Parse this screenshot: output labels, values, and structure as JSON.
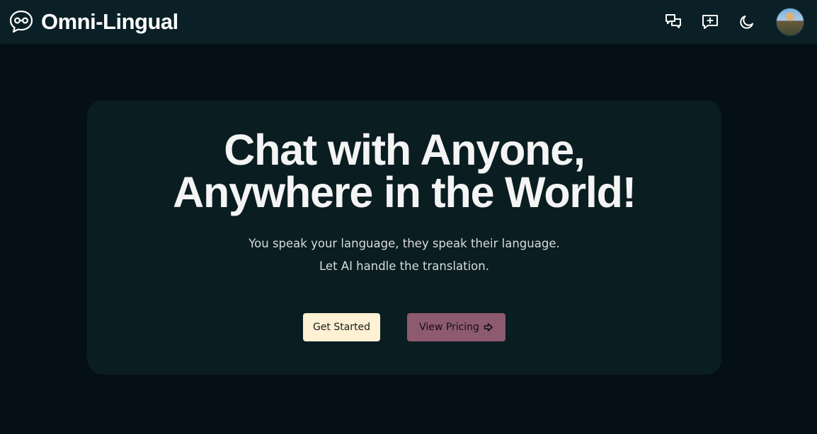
{
  "header": {
    "brand_name": "Omni-Lingual",
    "icons": [
      "chat-bubbles-icon",
      "new-chat-icon",
      "moon-icon"
    ]
  },
  "hero": {
    "title_line_1": "Chat with Anyone,",
    "title_line_2": "Anywhere in the World!",
    "subtitle_line_1": "You speak your language, they speak their language.",
    "subtitle_line_2": "Let AI handle the translation."
  },
  "cta": {
    "get_started_label": "Get Started",
    "view_pricing_label": "View Pricing"
  },
  "colors": {
    "page_bg": "#041015",
    "navbar_bg": "#0a2026",
    "card_bg": "#0a1d21",
    "primary_button": "#fdf0d3",
    "secondary_button": "#8e5a6f"
  }
}
